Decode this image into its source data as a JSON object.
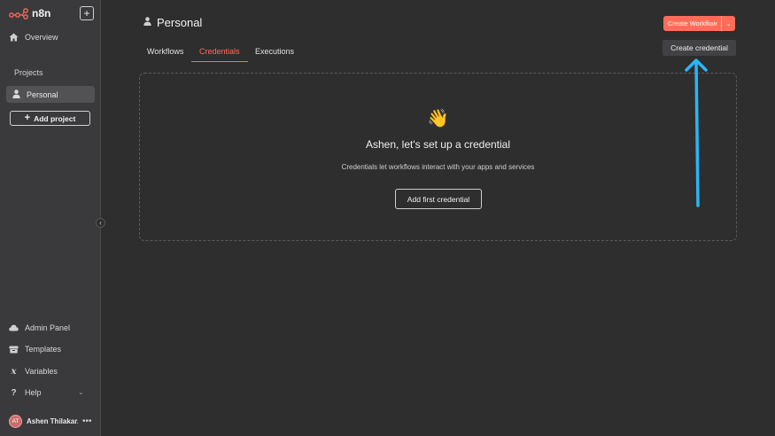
{
  "app": {
    "logo_text": "n8n",
    "new_button_label": "+"
  },
  "sidebar": {
    "overview_label": "Overview",
    "projects_title": "Projects",
    "personal_label": "Personal",
    "add_project_label": "Add project",
    "admin_panel_label": "Admin Panel",
    "templates_label": "Templates",
    "variables_label": "Variables",
    "help_label": "Help",
    "user": {
      "initials": "AT",
      "name": "Ashen Thilakar..."
    }
  },
  "header": {
    "title": "Personal",
    "create_workflow_label": "Create Workflow",
    "create_credential_label": "Create credential"
  },
  "tabs": [
    {
      "label": "Workflows",
      "active": false
    },
    {
      "label": "Credentials",
      "active": true
    },
    {
      "label": "Executions",
      "active": false
    }
  ],
  "empty_state": {
    "emoji": "👋",
    "title": "Ashen, let's set up a credential",
    "description": "Credentials let workflows interact with your apps and services",
    "button_label": "Add first credential"
  },
  "colors": {
    "accent": "#ff6d5a",
    "annotation_arrow": "#29b6f6"
  },
  "icons": {
    "overview": "home-icon",
    "personal": "user-icon",
    "admin": "cloud-icon",
    "templates": "box-icon",
    "variables": "variable-icon",
    "help": "question-icon"
  }
}
